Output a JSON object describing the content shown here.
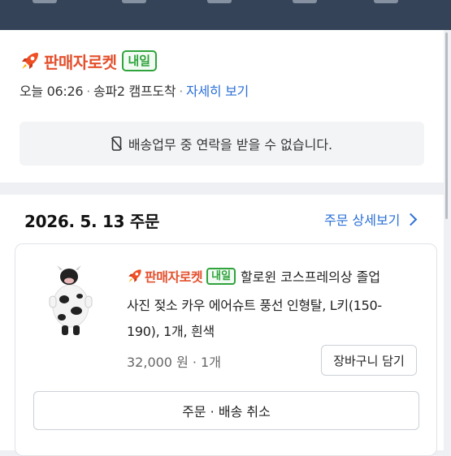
{
  "colors": {
    "topbar": "#344358",
    "brand": "#e4502d",
    "badge": "#2fa33c",
    "link": "#2a6fd6"
  },
  "delivery": {
    "brand": "판매자로켓",
    "badge": "내일",
    "time": "오늘 06:26",
    "location": "송파2 캠프도착",
    "detail_link": "자세히 보기",
    "notice": "배송업무 중 연락을 받을 수 없습니다."
  },
  "order": {
    "date": "2026. 5. 13 주문",
    "detail_link": "주문 상세보기",
    "item": {
      "brand": "판매자로켓",
      "badge": "내일",
      "title_line1": "할로윈 코스프레의상 졸업",
      "title_line2": "사진 젖소 카우 에어슈트 풍선 인형탈, L키(150-",
      "title_line3": "190), 1개, 흰색",
      "price": "32,000 원 · 1개",
      "cart_button": "장바구니 담기"
    },
    "cancel_button": "주문 · 배송 취소"
  },
  "icons": [
    "rocket-icon",
    "phone-off-icon",
    "chevron-right-icon",
    "product-thumbnail"
  ]
}
